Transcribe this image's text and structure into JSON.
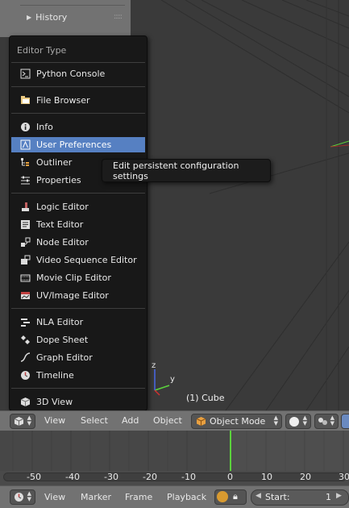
{
  "toolshelf": {
    "history_label": "History"
  },
  "viewport": {
    "object_label": "(1) Cube",
    "axis_y": "y",
    "axis_z": "z"
  },
  "menu": {
    "title": "Editor Type",
    "items": [
      {
        "label": "Python Console",
        "icon": "python-console-icon"
      },
      {
        "label": "File Browser",
        "icon": "file-browser-icon"
      },
      {
        "label": "Info",
        "icon": "info-icon"
      },
      {
        "label": "User Preferences",
        "icon": "user-preferences-icon",
        "active": true
      },
      {
        "label": "Outliner",
        "icon": "outliner-icon"
      },
      {
        "label": "Properties",
        "icon": "properties-icon"
      },
      {
        "label": "Logic Editor",
        "icon": "logic-editor-icon"
      },
      {
        "label": "Text Editor",
        "icon": "text-editor-icon"
      },
      {
        "label": "Node Editor",
        "icon": "node-editor-icon"
      },
      {
        "label": "Video Sequence Editor",
        "icon": "sequencer-icon"
      },
      {
        "label": "Movie Clip Editor",
        "icon": "movie-clip-icon"
      },
      {
        "label": "UV/Image Editor",
        "icon": "image-editor-icon"
      },
      {
        "label": "NLA Editor",
        "icon": "nla-icon"
      },
      {
        "label": "Dope Sheet",
        "icon": "dope-sheet-icon"
      },
      {
        "label": "Graph Editor",
        "icon": "graph-editor-icon"
      },
      {
        "label": "Timeline",
        "icon": "timeline-icon"
      },
      {
        "label": "3D View",
        "icon": "view3d-icon"
      }
    ]
  },
  "tooltip": {
    "text": "Edit persistent configuration settings"
  },
  "header3d": {
    "view": "View",
    "select": "Select",
    "add": "Add",
    "object": "Object",
    "mode": "Object Mode"
  },
  "timeline": {
    "ticks": [
      "-50",
      "-40",
      "-30",
      "-20",
      "-10",
      "0",
      "10",
      "20",
      "30"
    ]
  },
  "timeline_header": {
    "view": "View",
    "marker": "Marker",
    "frame": "Frame",
    "playback": "Playback",
    "start_label": "Start:",
    "start_value": "1"
  },
  "colors": {
    "accent": "#5680c2",
    "frame_cursor": "#5bd23c"
  }
}
